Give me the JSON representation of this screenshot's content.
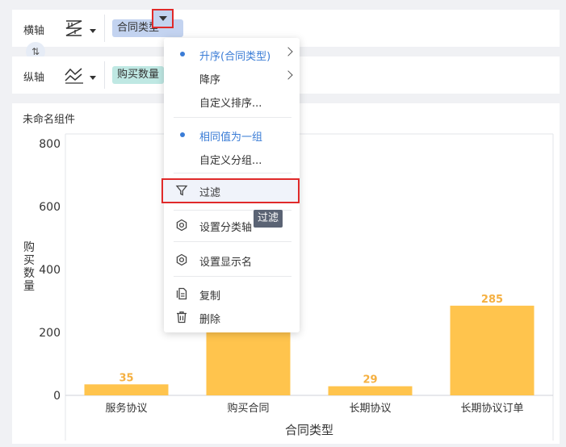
{
  "axes": {
    "x": {
      "label": "横轴",
      "icon": "sort-bars-icon",
      "field": "合同类型"
    },
    "y": {
      "label": "纵轴",
      "icon": "line-chart-icon",
      "field": "购买数量"
    },
    "swap_icon": "swap-vertical-icon"
  },
  "panel": {
    "title": "未命名组件"
  },
  "chart_data": {
    "type": "bar",
    "categories": [
      "服务协议",
      "购买合同",
      "长期协议",
      "长期协议订单"
    ],
    "values": [
      35,
      null,
      29,
      285
    ],
    "data_labels": [
      "35",
      "",
      "29",
      "285"
    ],
    "xlabel": "合同类型",
    "ylabel": "购买数量",
    "y_ticks": [
      "800",
      "600",
      "400",
      "200",
      "0"
    ],
    "ylim": [
      0,
      800
    ],
    "bar_color": "#ffc44d",
    "label_color": "#f5b041",
    "grid": true
  },
  "menu": {
    "items": [
      {
        "label": "升序(合同类型)",
        "selected": true,
        "submenu": true
      },
      {
        "label": "降序",
        "submenu": true
      },
      {
        "label": "自定义排序..."
      },
      {
        "label": "相同值为一组",
        "selected": true
      },
      {
        "label": "自定义分组..."
      },
      {
        "label": "过滤",
        "icon": "filter-icon",
        "highlighted": true
      },
      {
        "label": "设置分类轴",
        "icon": "gear-icon"
      },
      {
        "label": "设置显示名",
        "icon": "gear-icon"
      },
      {
        "label": "复制",
        "icon": "copy-icon"
      },
      {
        "label": "删除",
        "icon": "trash-icon"
      }
    ],
    "tooltip": "过滤"
  },
  "colors": {
    "accent": "#3a7cd6",
    "highlight_border": "#e02a2a",
    "chip_blue": "#c3d3f0",
    "chip_green": "#bfe8e3"
  }
}
